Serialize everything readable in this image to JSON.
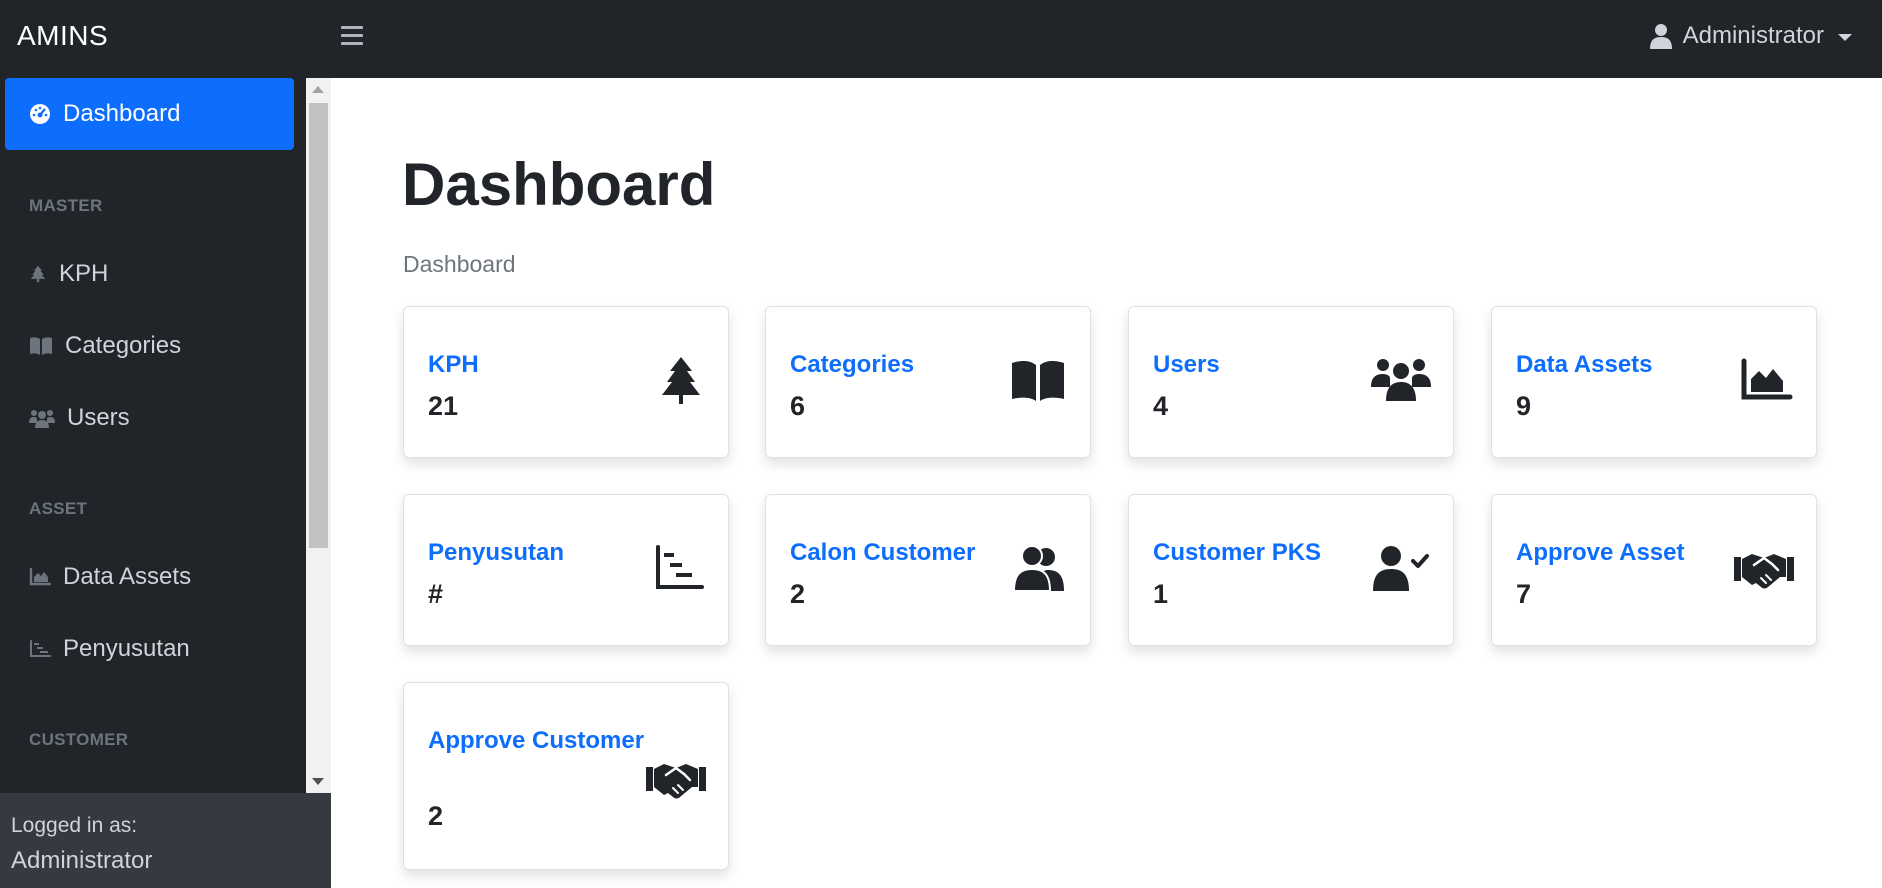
{
  "app": {
    "brand": "AMINS"
  },
  "header": {
    "user_name": "Administrator"
  },
  "sidebar": {
    "active_item": "Dashboard",
    "sections": [
      {
        "heading": "MASTER",
        "items": [
          "KPH",
          "Categories",
          "Users"
        ]
      },
      {
        "heading": "ASSET",
        "items": [
          "Data Assets",
          "Penyusutan"
        ]
      },
      {
        "heading": "CUSTOMER",
        "items": []
      }
    ],
    "footer": {
      "label": "Logged in as:",
      "user": "Administrator"
    }
  },
  "main": {
    "title": "Dashboard",
    "breadcrumb": "Dashboard",
    "cards": [
      {
        "title": "KPH",
        "value": "21",
        "icon": "tree-icon"
      },
      {
        "title": "Categories",
        "value": "6",
        "icon": "book-open-icon"
      },
      {
        "title": "Users",
        "value": "4",
        "icon": "users-icon"
      },
      {
        "title": "Data Assets",
        "value": "9",
        "icon": "chart-area-icon"
      },
      {
        "title": "Penyusutan",
        "value": "#",
        "icon": "chart-gantt-icon"
      },
      {
        "title": "Calon Customer",
        "value": "2",
        "icon": "user-group-icon"
      },
      {
        "title": "Customer PKS",
        "value": "1",
        "icon": "user-check-icon"
      },
      {
        "title": "Approve Asset",
        "value": "7",
        "icon": "handshake-icon"
      },
      {
        "title": "Approve Customer",
        "value": "2",
        "icon": "handshake-icon"
      }
    ]
  }
}
